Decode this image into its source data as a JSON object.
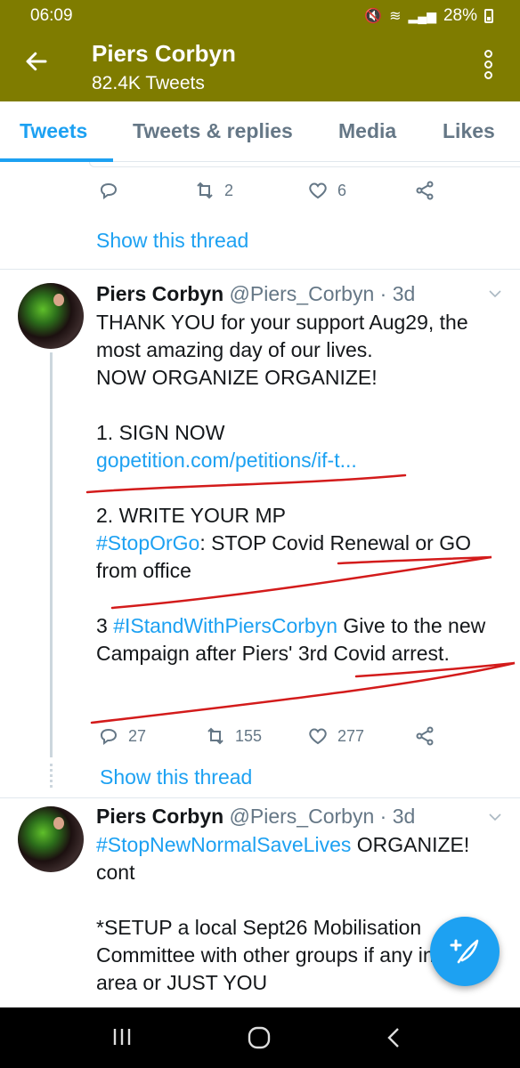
{
  "status_bar": {
    "time": "06:09",
    "battery": "28%"
  },
  "header": {
    "title": "Piers Corbyn",
    "subtitle": "82.4K Tweets",
    "back_icon": "arrow-left-icon",
    "more_icon": "more-vertical-icon"
  },
  "tabs": [
    {
      "label": "Tweets",
      "active": true
    },
    {
      "label": "Tweets & replies",
      "active": false
    },
    {
      "label": "Media",
      "active": false
    },
    {
      "label": "Likes",
      "active": false
    }
  ],
  "prev_tweet": {
    "actions": {
      "reply": "",
      "retweet": "2",
      "like": "6"
    },
    "show_thread": "Show this thread"
  },
  "tweet1": {
    "name": "Piers Corbyn",
    "handle": "@Piers_Corbyn",
    "time": "3d",
    "lines": [
      "THANK YOU for your support Aug29, the most amazing day of our lives.",
      "NOW ORGANIZE ORGANIZE!",
      "1. SIGN NOW",
      "gopetition.com/petitions/if-t...",
      "2. WRITE YOUR MP",
      "#StopOrGo",
      ": STOP Covid Renewal or GO from office",
      "3 ",
      "#IStandWithPiersCorbyn",
      " Give to the new Campaign after Piers' 3rd Covid arrest."
    ],
    "actions": {
      "reply": "27",
      "retweet": "155",
      "like": "277"
    },
    "show_thread": "Show this thread"
  },
  "tweet2": {
    "name": "Piers Corbyn",
    "handle": "@Piers_Corbyn",
    "time": "3d",
    "hashtag": "#StopNewNormalSaveLives",
    "line1_rest": " ORGANIZE! cont",
    "line2": "*SETUP a local Sept26 Mobilisation Committee with other groups if any in your area or JUST YOU"
  },
  "colors": {
    "brand_bar": "#7f7c00",
    "link": "#1da1f2",
    "scribble": "#d31b1b"
  }
}
